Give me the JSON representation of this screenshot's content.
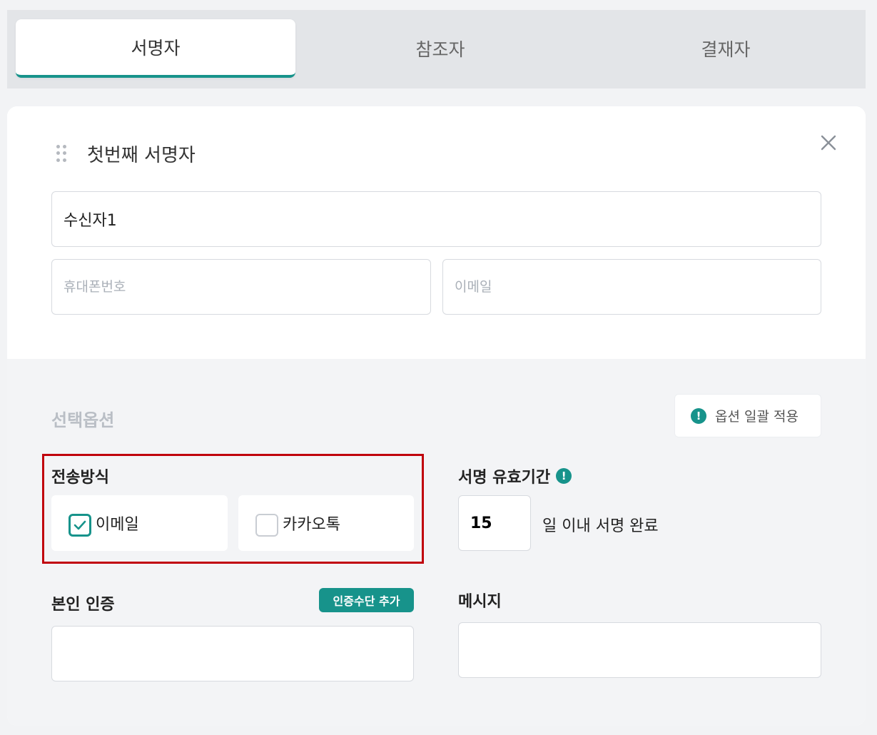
{
  "tabs": [
    {
      "label": "서명자",
      "active": true
    },
    {
      "label": "참조자",
      "active": false
    },
    {
      "label": "결재자",
      "active": false
    }
  ],
  "signer": {
    "title": "첫번째 서명자",
    "name_value": "수신자1",
    "phone_placeholder": "휴대폰번호",
    "email_placeholder": "이메일"
  },
  "options": {
    "title": "선택옵션",
    "apply_all_label": "옵션 일괄 적용",
    "info_glyph": "!",
    "send_method": {
      "label": "전송방식",
      "email_label": "이메일",
      "email_checked": true,
      "kakao_label": "카카오톡",
      "kakao_checked": false
    },
    "expiry": {
      "label": "서명 유효기간",
      "days": "15",
      "suffix": "일 이내 서명 완료"
    },
    "auth": {
      "label": "본인 인증",
      "add_label": "인증수단 추가"
    },
    "message": {
      "label": "메시지"
    }
  },
  "colors": {
    "accent": "#17938b",
    "highlight": "#c0000c"
  },
  "icons": [
    "drag-handle-icon",
    "close-icon",
    "info-icon",
    "check-icon"
  ]
}
